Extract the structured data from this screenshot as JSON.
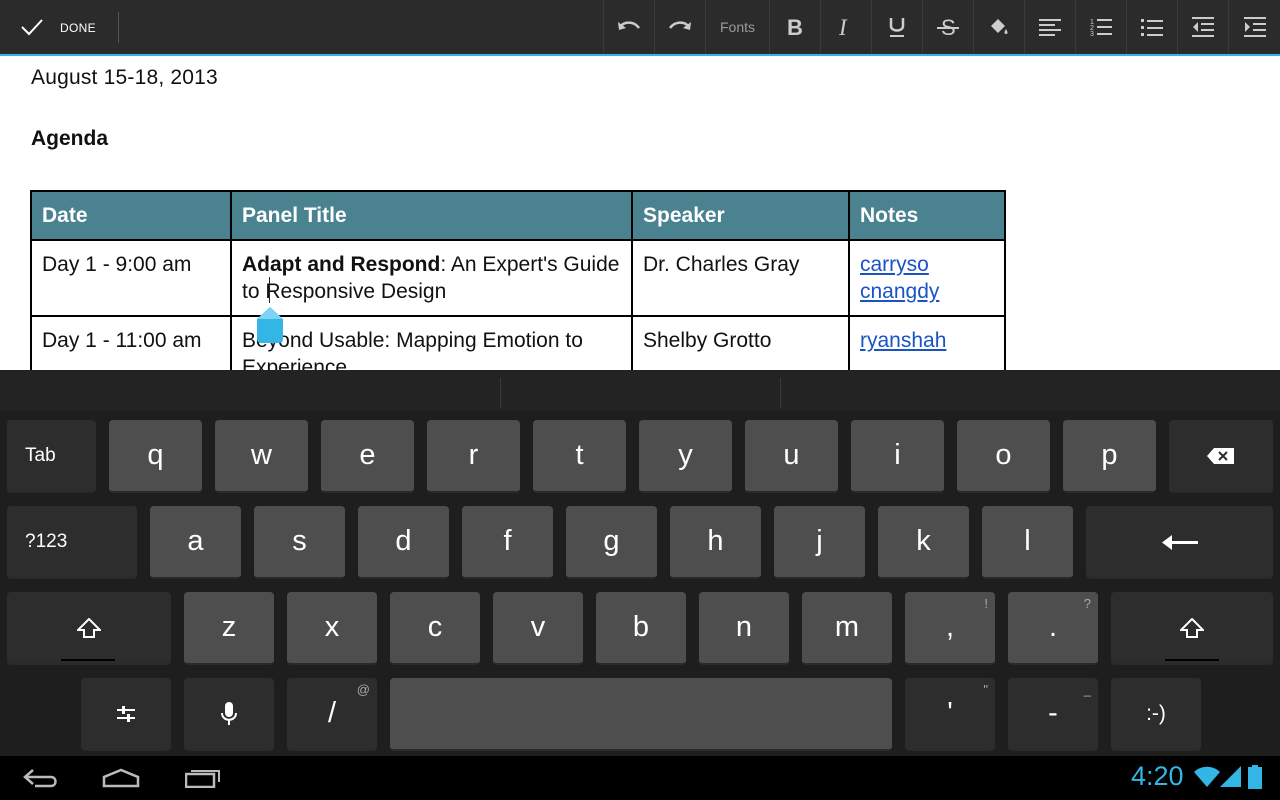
{
  "toolbar": {
    "done_label": "DONE",
    "fonts_label": "Fonts",
    "accent_color": "#33b5e5",
    "icons": [
      "undo-icon",
      "redo-icon",
      "bold-icon",
      "italic-icon",
      "underline-icon",
      "strikethrough-icon",
      "fill-color-icon",
      "align-left-icon",
      "numbered-list-icon",
      "bulleted-list-icon",
      "decrease-indent-icon",
      "increase-indent-icon"
    ]
  },
  "document": {
    "date_line": "August 15-18, 2013",
    "heading": "Agenda",
    "table": {
      "header_color": "#4a8290",
      "headers": [
        "Date",
        "Panel Title",
        "Speaker",
        "Notes"
      ],
      "rows": [
        {
          "date": "Day 1 - 9:00 am",
          "title_bold": "Adapt and Respond",
          "title_rest": ": An Expert's Guide to Responsive Design",
          "speaker": "Dr. Charles Gray",
          "notes": [
            "carryso",
            "cnangdy"
          ]
        },
        {
          "date": "Day 1 - 11:00 am",
          "title_bold": "",
          "title_rest": "Beyond Usable: Mapping Emotion to Experience",
          "speaker": "Shelby Grotto",
          "notes": [
            "ryanshah"
          ]
        }
      ]
    }
  },
  "keyboard": {
    "row1": [
      "Tab",
      "q",
      "w",
      "e",
      "r",
      "t",
      "y",
      "u",
      "i",
      "o",
      "p"
    ],
    "row2": [
      "?123",
      "a",
      "s",
      "d",
      "f",
      "g",
      "h",
      "j",
      "k",
      "l"
    ],
    "row3": [
      "z",
      "x",
      "c",
      "v",
      "b",
      "n",
      "m",
      ",",
      "."
    ],
    "row3_hints": {
      "comma": "!",
      "period": "?"
    },
    "row4": {
      "slash": "/",
      "slash_hint": "@",
      "apostrophe": "'",
      "apostrophe_hint": "\"",
      "dash": "-",
      "dash_hint": "_",
      "smiley": ":-)"
    }
  },
  "status": {
    "time": "4:20",
    "time_color": "#33b5e5"
  }
}
